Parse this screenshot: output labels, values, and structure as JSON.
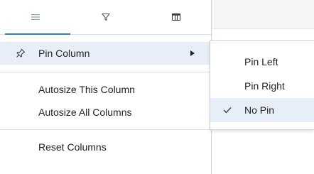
{
  "tabs": [
    {
      "icon": "menu-lines-icon",
      "active": true
    },
    {
      "icon": "filter-icon",
      "active": false
    },
    {
      "icon": "columns-icon",
      "active": false
    }
  ],
  "menu": {
    "pin_column": "Pin Column",
    "autosize_this": "Autosize This Column",
    "autosize_all": "Autosize All Columns",
    "reset_columns": "Reset Columns"
  },
  "submenu": {
    "pin_left": "Pin Left",
    "pin_right": "Pin Right",
    "no_pin": "No Pin",
    "selected": "no_pin"
  },
  "colors": {
    "accent": "#2f7ecb",
    "highlight": "#e7eef8",
    "border": "#cfd3d8"
  }
}
